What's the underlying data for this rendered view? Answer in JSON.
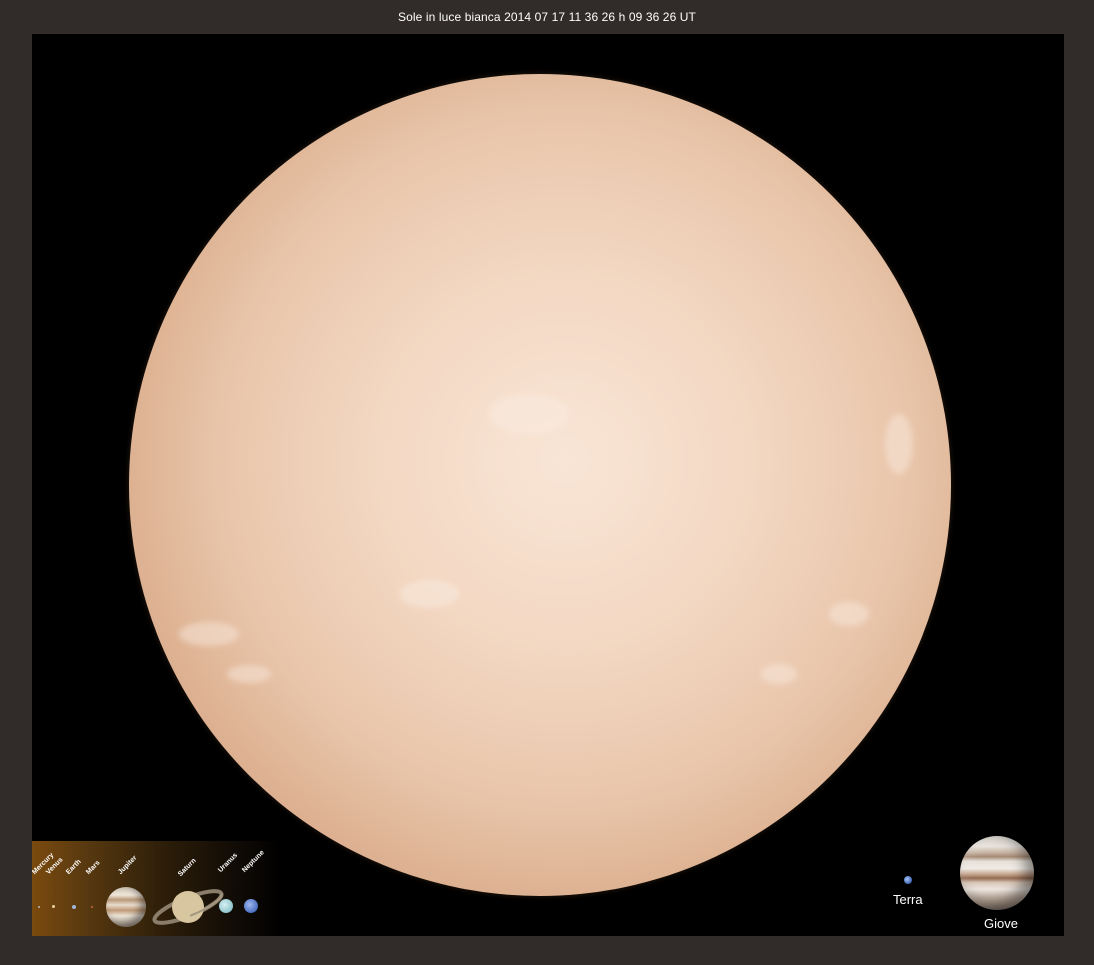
{
  "title": "Sole in luce bianca 2014 07 17 11 36 26 h 09 36 26 UT",
  "legend_planets": [
    "Mercury",
    "Venus",
    "Earth",
    "Mars",
    "Jupiter",
    "Saturn",
    "Uranus",
    "Neptune"
  ],
  "comparisons": {
    "earth_label": "Terra",
    "jupiter_label": "Giove"
  },
  "colors": {
    "background": "#312b29",
    "sun_center": "#f9e5d6",
    "sun_limb": "#8a5c40"
  }
}
